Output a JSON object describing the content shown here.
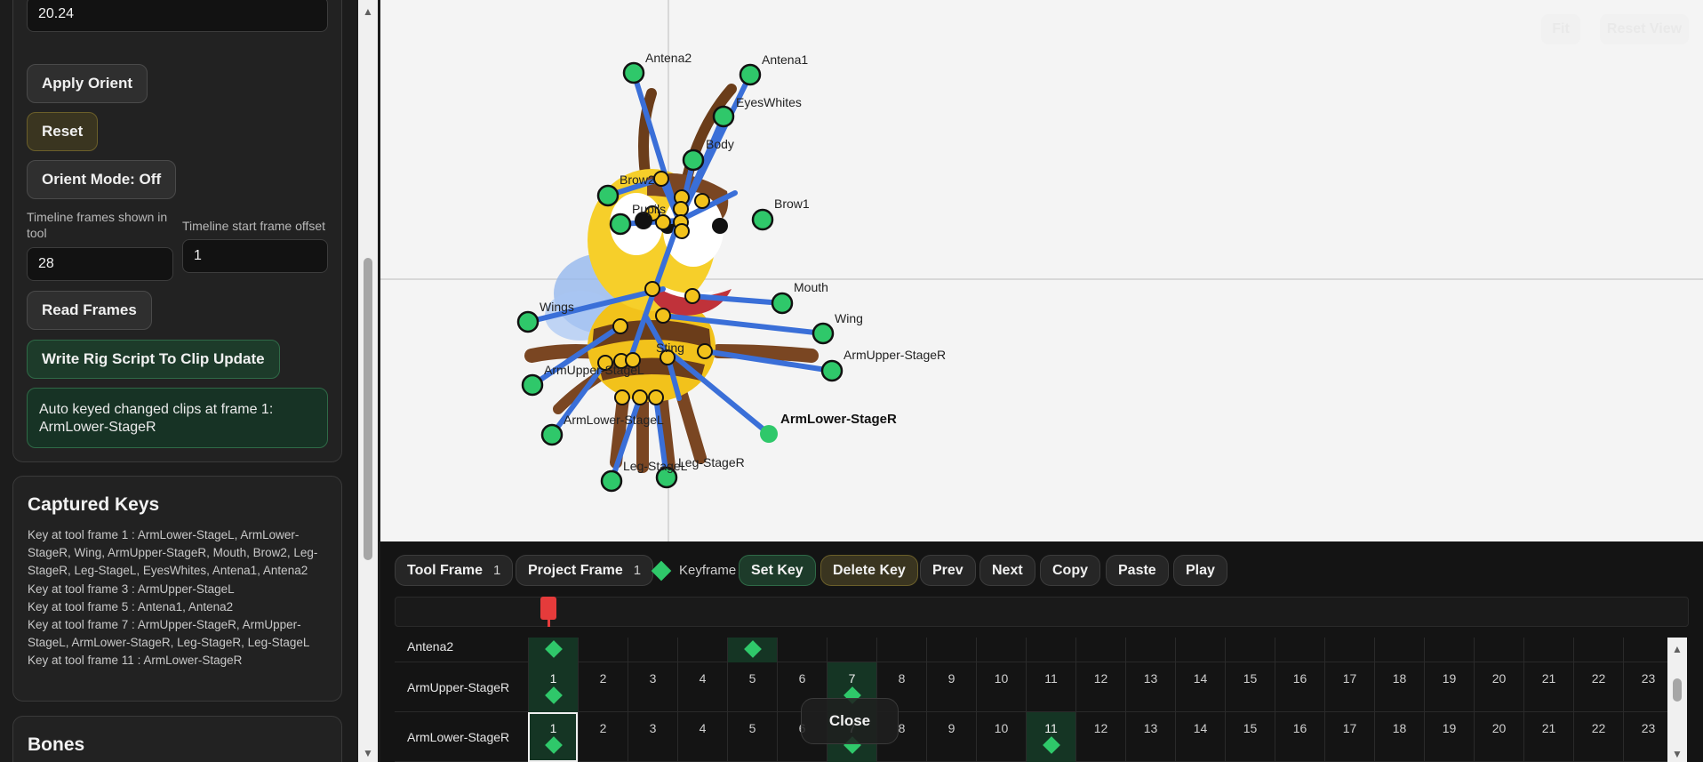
{
  "left_panel": {
    "angle_value": "20.24",
    "apply_orient_label": "Apply Orient",
    "reset_label": "Reset",
    "orient_mode_label": "Orient Mode: Off",
    "frames_shown_label": "Timeline frames shown in tool",
    "frames_shown_value": "28",
    "start_offset_label": "Timeline start frame offset",
    "start_offset_value": "1",
    "read_frames_label": "Read Frames",
    "write_rig_label": "Write Rig Script To Clip Update",
    "status_text": "Auto keyed changed clips at frame 1: ArmLower-StageR",
    "captured_keys_title": "Captured Keys",
    "captured_keys": [
      "Key at tool frame 1 : ArmLower-StageL, ArmLower-StageR, Wing, ArmUpper-StageR, Mouth, Brow2, Leg-StageR, Leg-StageL, EyesWhites, Antena1, Antena2",
      "Key at tool frame 3 : ArmUpper-StageL",
      "Key at tool frame 5 : Antena1, Antena2",
      "Key at tool frame 7 : ArmUpper-StageR, ArmUpper-StageL, ArmLower-StageR, Leg-StageR, Leg-StageL",
      "Key at tool frame 11 : ArmLower-StageR"
    ],
    "bones_title": "Bones"
  },
  "canvas": {
    "fit_label": "Fit",
    "reset_view_label": "Reset View",
    "colors": {
      "bone": "#3a6fd8",
      "end_node": "#2fc86a",
      "joint": "#f2c21b"
    },
    "bone_labels": [
      {
        "text": "Antena2"
      },
      {
        "text": "Antena1"
      },
      {
        "text": "EyesWhites"
      },
      {
        "text": "Body"
      },
      {
        "text": "Brow2"
      },
      {
        "text": "Brow1"
      },
      {
        "text": "Pupils"
      },
      {
        "text": "Mouth"
      },
      {
        "text": "Wing"
      },
      {
        "text": "Wings"
      },
      {
        "text": "Sting"
      },
      {
        "text": "ArmUpper-StageR"
      },
      {
        "text": "ArmUpper-StageL"
      },
      {
        "text": "ArmLower-StageL"
      },
      {
        "text": "ArmLower-StageR"
      },
      {
        "text": "Leg-StageL"
      },
      {
        "text": "Leg-StageR"
      }
    ]
  },
  "timeline": {
    "tool_frame_label": "Tool Frame",
    "tool_frame_value": "1",
    "project_frame_label": "Project Frame",
    "project_frame_value": "1",
    "keyframe_legend": "Keyframe",
    "set_key_label": "Set Key",
    "delete_key_label": "Delete Key",
    "prev_label": "Prev",
    "next_label": "Next",
    "copy_label": "Copy",
    "paste_label": "Paste",
    "play_label": "Play",
    "close_label": "Close",
    "frames": [
      "1",
      "2",
      "3",
      "4",
      "5",
      "6",
      "7",
      "8",
      "9",
      "10",
      "11",
      "12",
      "13",
      "14",
      "15",
      "16",
      "17",
      "18",
      "19",
      "20",
      "21",
      "22",
      "23"
    ],
    "rows": [
      {
        "name": "Antena2",
        "keys": [
          1,
          5
        ]
      },
      {
        "name": "ArmUpper-StageR",
        "keys": [
          1,
          7
        ]
      },
      {
        "name": "ArmLower-StageR",
        "keys": [
          1,
          7,
          11
        ]
      }
    ],
    "current_frame": 1
  }
}
